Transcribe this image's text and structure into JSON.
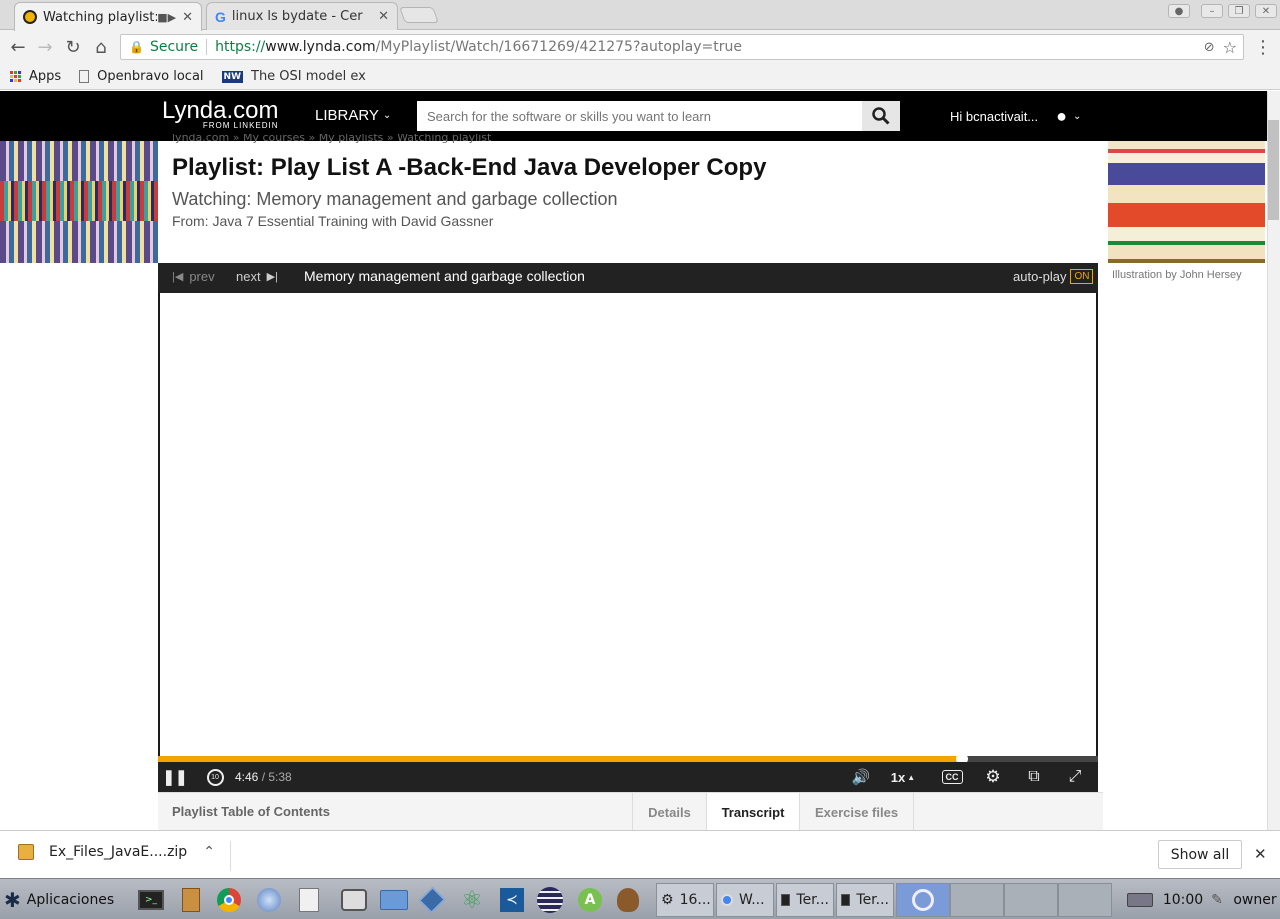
{
  "browser": {
    "tabs": [
      {
        "title": "Watching playlist:",
        "active": true
      },
      {
        "title": "linux ls bydate - Cer",
        "active": false
      }
    ],
    "secure_label": "Secure",
    "url_scheme": "https://",
    "url_host": "www.lynda.com",
    "url_path": "/MyPlaylist/Watch/16671269/421275?autoplay=true",
    "bookmarks": [
      "Apps",
      "Openbravo local",
      "The OSI model ex"
    ]
  },
  "header": {
    "logo_main": "Lynda.com",
    "logo_sub": "FROM LINKEDIN",
    "library_label": "LIBRARY",
    "search_placeholder": "Search for the software or skills you want to learn",
    "user_greeting": "Hi bcnactivait..."
  },
  "page": {
    "breadcrumb": "lynda.com  »  My courses  »  My playlists  »  Watching playlist",
    "title": "Playlist: Play List A -Back-End Java Developer Copy",
    "watching": "Watching: Memory management and garbage collection",
    "from": "From: Java 7 Essential Training with David Gassner",
    "illustration_credit": "Illustration by John Hersey"
  },
  "player": {
    "prev_label": "prev",
    "next_label": "next",
    "video_title": "Memory management and garbage collection",
    "autoplay_label": "auto-play",
    "autoplay_state": "ON",
    "current_time": "4:46",
    "duration": "5:38",
    "progress_fraction": 0.855,
    "speed": "1x",
    "cc_label": "CC",
    "rewind_seconds": "10",
    "accent_color": "#f4a400"
  },
  "lower_tabs": {
    "toc": "Playlist Table of Contents",
    "details": "Details",
    "transcript": "Transcript",
    "exercise": "Exercise files"
  },
  "downloads": {
    "file": "Ex_Files_JavaE....zip",
    "show_all": "Show all"
  },
  "taskbar": {
    "apps_label": "Aplicaciones",
    "windows": [
      "16...",
      "W...",
      "Ter...",
      "Ter..."
    ],
    "clock": "10:00",
    "user": "owner"
  }
}
